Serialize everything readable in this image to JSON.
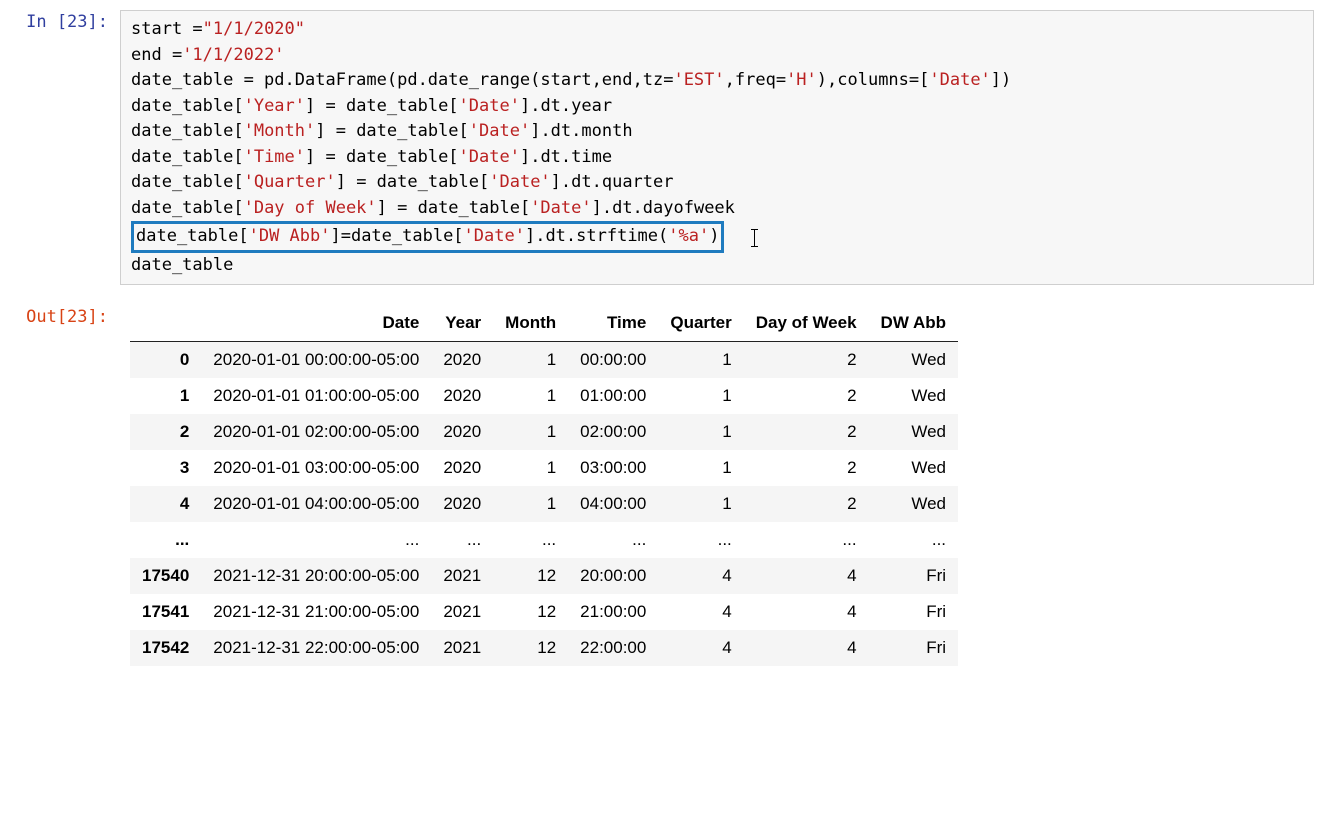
{
  "input": {
    "prompt": "In [23]:",
    "lines": [
      [
        {
          "t": "start ="
        },
        {
          "t": "\"1/1/2020\"",
          "c": "str"
        }
      ],
      [
        {
          "t": "end ="
        },
        {
          "t": "'1/1/2022'",
          "c": "str"
        }
      ],
      [
        {
          "t": "date_table = pd.DataFrame(pd.date_range(start,end,tz="
        },
        {
          "t": "'EST'",
          "c": "str"
        },
        {
          "t": ",freq="
        },
        {
          "t": "'H'",
          "c": "str"
        },
        {
          "t": "),columns=["
        },
        {
          "t": "'Date'",
          "c": "str"
        },
        {
          "t": "])"
        }
      ],
      [
        {
          "t": "date_table["
        },
        {
          "t": "'Year'",
          "c": "str"
        },
        {
          "t": "] = date_table["
        },
        {
          "t": "'Date'",
          "c": "str"
        },
        {
          "t": "].dt.year"
        }
      ],
      [
        {
          "t": "date_table["
        },
        {
          "t": "'Month'",
          "c": "str"
        },
        {
          "t": "] = date_table["
        },
        {
          "t": "'Date'",
          "c": "str"
        },
        {
          "t": "].dt.month"
        }
      ],
      [
        {
          "t": "date_table["
        },
        {
          "t": "'Time'",
          "c": "str"
        },
        {
          "t": "] = date_table["
        },
        {
          "t": "'Date'",
          "c": "str"
        },
        {
          "t": "].dt.time"
        }
      ],
      [
        {
          "t": "date_table["
        },
        {
          "t": "'Quarter'",
          "c": "str"
        },
        {
          "t": "] = date_table["
        },
        {
          "t": "'Date'",
          "c": "str"
        },
        {
          "t": "].dt.quarter"
        }
      ],
      [
        {
          "t": "date_table["
        },
        {
          "t": "'Day of Week'",
          "c": "str"
        },
        {
          "t": "] = date_table["
        },
        {
          "t": "'Date'",
          "c": "str"
        },
        {
          "t": "].dt.dayofweek"
        }
      ]
    ],
    "highlight_line": [
      {
        "t": "date_table["
      },
      {
        "t": "'DW Abb'",
        "c": "str"
      },
      {
        "t": "]=date_table["
      },
      {
        "t": "'Date'",
        "c": "str"
      },
      {
        "t": "].dt.strftime("
      },
      {
        "t": "'%a'",
        "c": "str"
      },
      {
        "t": ")"
      }
    ],
    "last_lines": [
      [
        {
          "t": "date_table"
        }
      ]
    ]
  },
  "output": {
    "prompt": "Out[23]:",
    "columns": [
      "",
      "Date",
      "Year",
      "Month",
      "Time",
      "Quarter",
      "Day of Week",
      "DW Abb"
    ],
    "rows": [
      {
        "idx": "0",
        "data": [
          "2020-01-01 00:00:00-05:00",
          "2020",
          "1",
          "00:00:00",
          "1",
          "2",
          "Wed"
        ]
      },
      {
        "idx": "1",
        "data": [
          "2020-01-01 01:00:00-05:00",
          "2020",
          "1",
          "01:00:00",
          "1",
          "2",
          "Wed"
        ]
      },
      {
        "idx": "2",
        "data": [
          "2020-01-01 02:00:00-05:00",
          "2020",
          "1",
          "02:00:00",
          "1",
          "2",
          "Wed"
        ]
      },
      {
        "idx": "3",
        "data": [
          "2020-01-01 03:00:00-05:00",
          "2020",
          "1",
          "03:00:00",
          "1",
          "2",
          "Wed"
        ]
      },
      {
        "idx": "4",
        "data": [
          "2020-01-01 04:00:00-05:00",
          "2020",
          "1",
          "04:00:00",
          "1",
          "2",
          "Wed"
        ]
      },
      {
        "idx": "...",
        "data": [
          "...",
          "...",
          "...",
          "...",
          "...",
          "...",
          "..."
        ]
      },
      {
        "idx": "17540",
        "data": [
          "2021-12-31 20:00:00-05:00",
          "2021",
          "12",
          "20:00:00",
          "4",
          "4",
          "Fri"
        ]
      },
      {
        "idx": "17541",
        "data": [
          "2021-12-31 21:00:00-05:00",
          "2021",
          "12",
          "21:00:00",
          "4",
          "4",
          "Fri"
        ]
      },
      {
        "idx": "17542",
        "data": [
          "2021-12-31 22:00:00-05:00",
          "2021",
          "12",
          "22:00:00",
          "4",
          "4",
          "Fri"
        ]
      }
    ]
  }
}
